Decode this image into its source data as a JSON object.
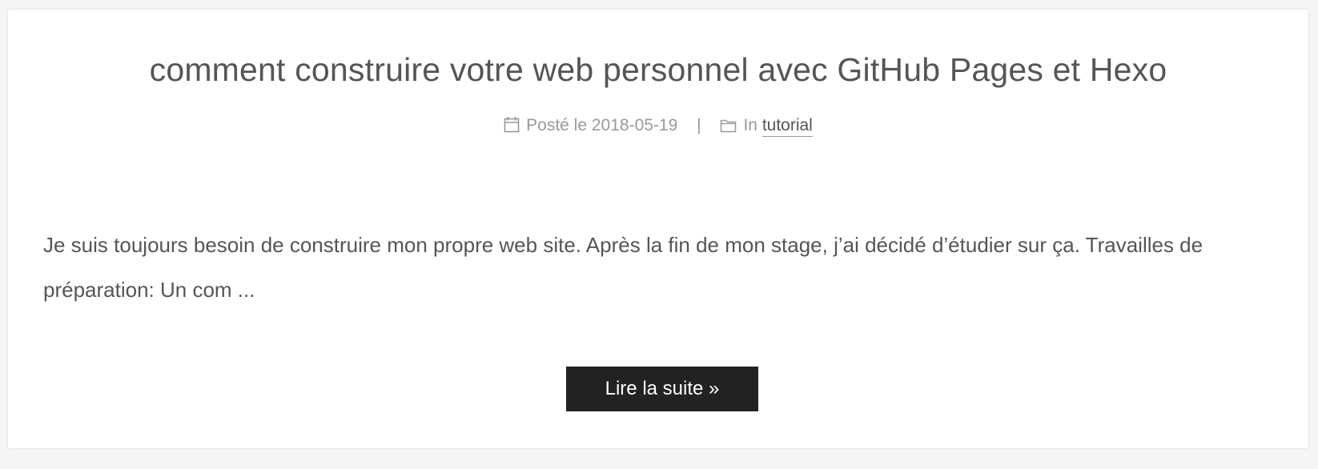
{
  "post": {
    "title": "comment construire votre web personnel avec GitHub Pages et Hexo",
    "meta": {
      "posted_label": "Posté le",
      "date": "2018-05-19",
      "divider": "|",
      "in_label": "In",
      "category": "tutorial",
      "calendar_icon": "calendar-icon",
      "folder_icon": "folder-icon"
    },
    "excerpt": "Je suis toujours besoin de construire mon propre web site. Après la fin de mon stage, j’ai décidé d’étudier sur ça. Travailles de préparation: Un com ...",
    "read_more_label": "Lire la suite »"
  },
  "colors": {
    "title": "#555555",
    "meta": "#999999",
    "button_bg": "#222222",
    "button_text": "#ffffff"
  }
}
